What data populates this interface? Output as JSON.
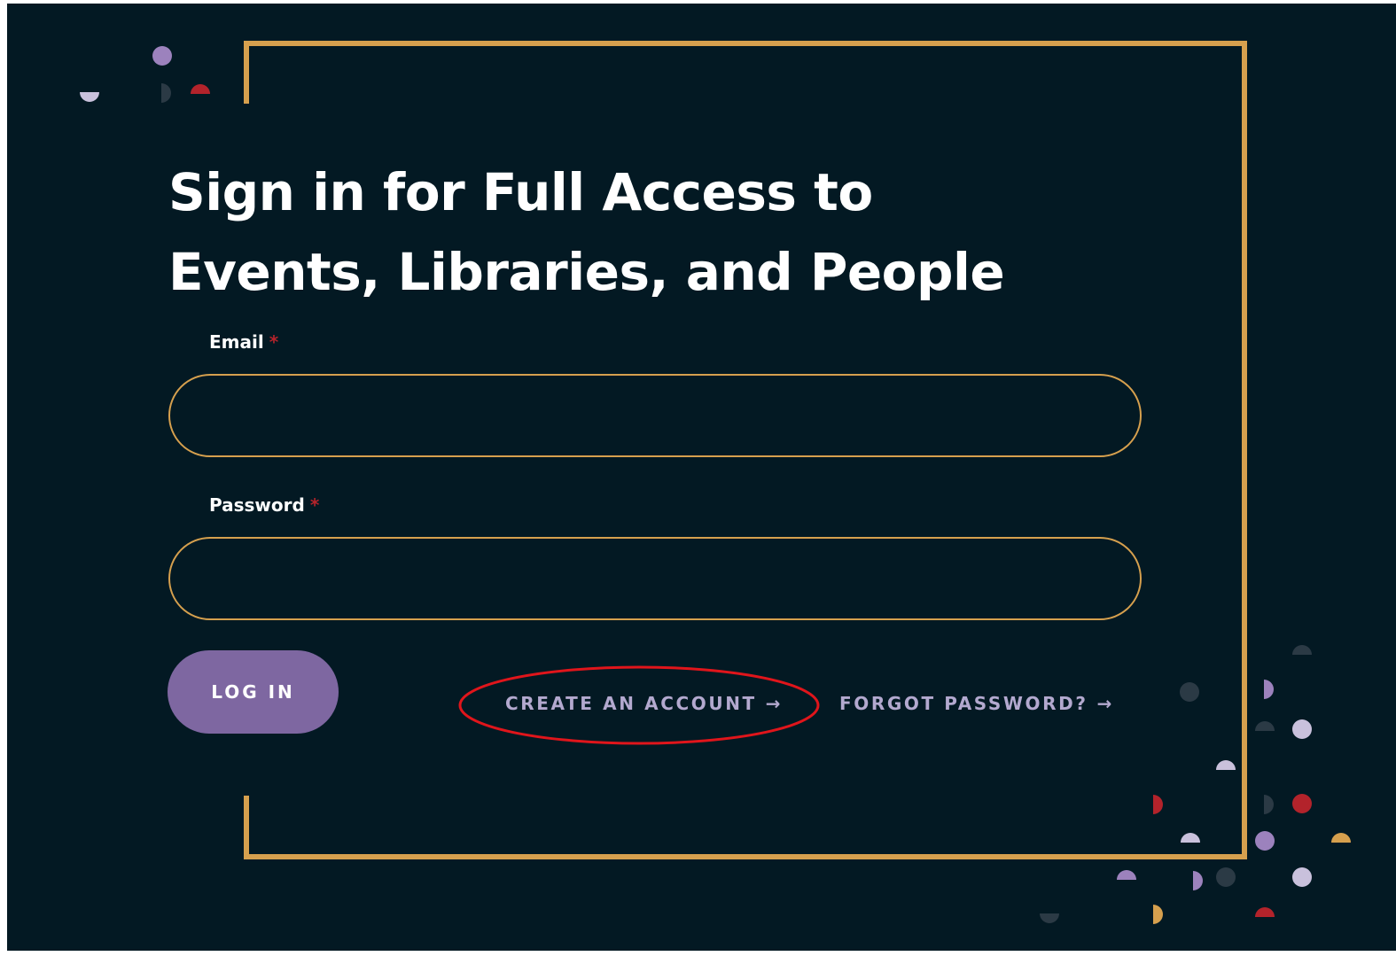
{
  "heading": {
    "line1": "Sign in for Full Access to",
    "line2": "Events, Libraries, and People"
  },
  "form": {
    "email_label": "Email",
    "email_required_mark": "*",
    "email_value": "",
    "password_label": "Password",
    "password_required_mark": "*",
    "password_value": "",
    "login_button_label": "LOG IN"
  },
  "links": {
    "create_account_label": "CREATE AN ACCOUNT",
    "forgot_password_label": "FORGOT PASSWORD?",
    "arrow_glyph": "→"
  },
  "colors": {
    "background": "#031923",
    "frame_gold": "#d6a04e",
    "login_purple": "#7e67a1",
    "link_lavender": "#b3a9cf",
    "required_red": "#b3232b",
    "annotation_red": "#e0151b",
    "decor_purple": "#9c82bd",
    "decor_lavender": "#c9c1dc",
    "decor_red": "#b3232b",
    "decor_gold": "#d6a04e",
    "decor_slate": "#2b3a45"
  },
  "icons": {
    "link_arrow": "arrow-right-icon",
    "decorations": "confetti-dots-decoration"
  }
}
